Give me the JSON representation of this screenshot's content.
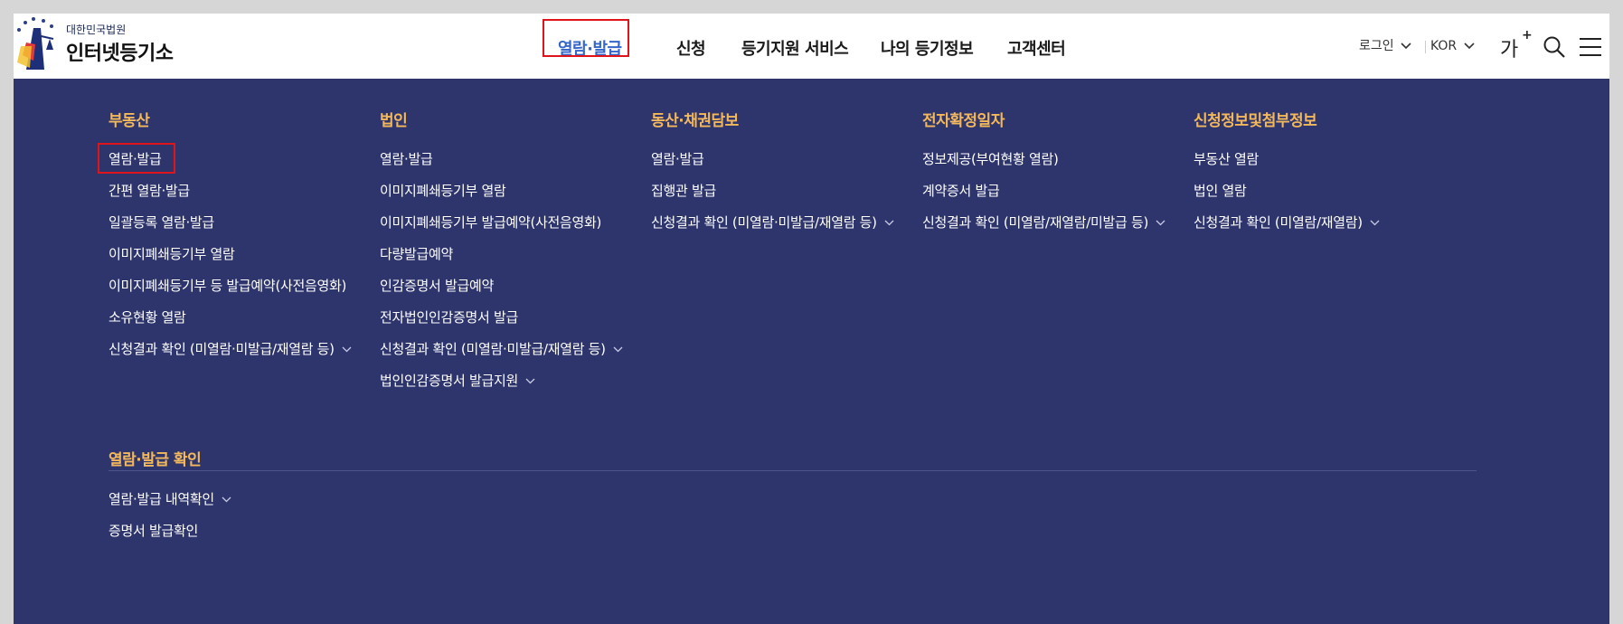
{
  "header": {
    "logo_sub": "대한민국법원",
    "logo_main": "인터넷등기소",
    "nav": [
      {
        "label": "열람·발급",
        "active": true
      },
      {
        "label": "신청",
        "active": false
      },
      {
        "label": "등기지원 서비스",
        "active": false
      },
      {
        "label": "나의 등기정보",
        "active": false
      },
      {
        "label": "고객센터",
        "active": false
      }
    ],
    "util": {
      "login_label": "로그인",
      "lang_label": "KOR",
      "font_size_label": "가",
      "font_size_plus": "+"
    }
  },
  "mega_menu": {
    "columns": [
      {
        "title": "부동산",
        "items": [
          {
            "label": "열람·발급",
            "expandable": false
          },
          {
            "label": "간편 열람·발급",
            "expandable": false
          },
          {
            "label": "일괄등록 열람·발급",
            "expandable": false
          },
          {
            "label": "이미지폐쇄등기부 열람",
            "expandable": false
          },
          {
            "label": "이미지폐쇄등기부 등 발급예약(사전음영화)",
            "expandable": false
          },
          {
            "label": "소유현황 열람",
            "expandable": false
          },
          {
            "label": "신청결과 확인 (미열람·미발급/재열람 등)",
            "expandable": true
          }
        ]
      },
      {
        "title": "법인",
        "items": [
          {
            "label": "열람·발급",
            "expandable": false
          },
          {
            "label": "이미지폐쇄등기부 열람",
            "expandable": false
          },
          {
            "label": "이미지폐쇄등기부 발급예약(사전음영화)",
            "expandable": false
          },
          {
            "label": "다량발급예약",
            "expandable": false
          },
          {
            "label": "인감증명서 발급예약",
            "expandable": false
          },
          {
            "label": "전자법인인감증명서 발급",
            "expandable": false
          },
          {
            "label": "신청결과 확인 (미열람·미발급/재열람 등)",
            "expandable": true
          },
          {
            "label": "법인인감증명서 발급지원",
            "expandable": true
          }
        ]
      },
      {
        "title": "동산·채권담보",
        "items": [
          {
            "label": "열람·발급",
            "expandable": false
          },
          {
            "label": "집행관 발급",
            "expandable": false
          },
          {
            "label": "신청결과 확인 (미열람·미발급/재열람 등)",
            "expandable": true
          }
        ]
      },
      {
        "title": "전자확정일자",
        "items": [
          {
            "label": "정보제공(부여현황 열람)",
            "expandable": false
          },
          {
            "label": "계약증서 발급",
            "expandable": false
          },
          {
            "label": "신청결과 확인 (미열람/재열람/미발급 등)",
            "expandable": true
          }
        ]
      },
      {
        "title": "신청정보및첨부정보",
        "items": [
          {
            "label": "부동산 열람",
            "expandable": false
          },
          {
            "label": "법인 열람",
            "expandable": false
          },
          {
            "label": "신청결과 확인 (미열람/재열람)",
            "expandable": true
          }
        ]
      }
    ],
    "bottom_section": {
      "title": "열람·발급 확인",
      "items": [
        {
          "label": "열람·발급 내역확인",
          "expandable": true
        },
        {
          "label": "증명서 발급확인",
          "expandable": false
        }
      ]
    }
  },
  "colors": {
    "header_bg": "#ffffff",
    "menu_bg": "#2e356c",
    "section_title": "#f4b85c",
    "active_nav": "#3566c8",
    "highlight_border": "#e0141b"
  }
}
